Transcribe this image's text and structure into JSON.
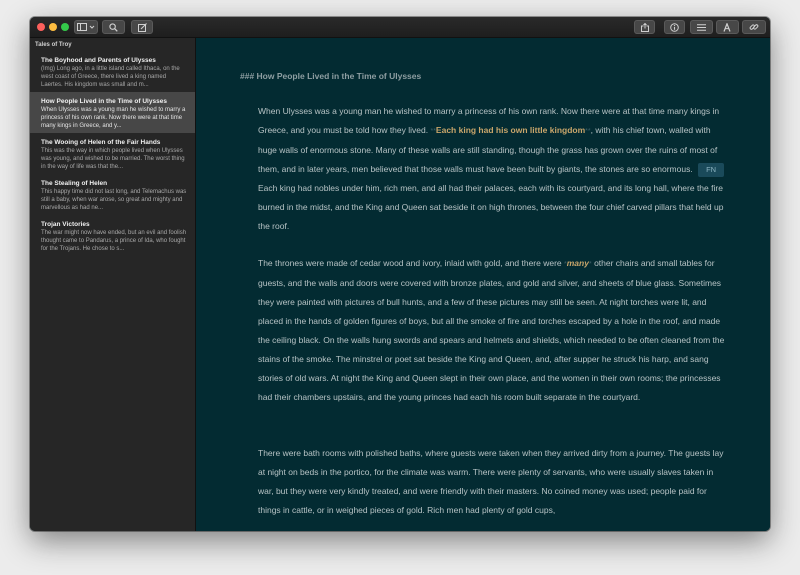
{
  "sidebar": {
    "title": "Tales of Troy",
    "notes": [
      {
        "title": "The Boyhood and Parents of Ulysses",
        "preview": "(Img) Long ago, in a little island called Ithaca, on the west coast of Greece, there lived a king named Laertes. His kingdom was small and m..."
      },
      {
        "title": "How People Lived in the Time of Ulysses",
        "preview": "When Ulysses was a young man he wished to marry a princess of his own rank. Now there were at that time many kings in Greece, and y..."
      },
      {
        "title": "The Wooing of Helen of the Fair Hands",
        "preview": "This was the way in which people lived when Ulysses was young, and wished to be married. The worst thing in the way of life was that the..."
      },
      {
        "title": "The Stealing of Helen",
        "preview": "This happy time did not last long, and Telemachus was still a baby, when war arose, so great and mighty and marvellous as had ne..."
      },
      {
        "title": "Trojan Victories",
        "preview": "The war might now have ended, but an evil and foolish thought came to Pandarus, a prince of Ida, who fought for the Trojans. He chose to s..."
      }
    ]
  },
  "editor": {
    "heading": "### How People Lived in the Time of Ulysses",
    "p1_a": "When Ulysses was a young man he wished to marry a princess of his own rank. Now there were at that time many kings in Greece, and you must be told how they lived. ",
    "p1_mk_open": "**",
    "p1_bold": "Each king had his own little kingdom",
    "p1_mk_close": "**",
    "p1_b": ", with his chief town, walled with huge walls of enormous stone. Many of these walls are still standing, though the grass has grown over the ruins of most of them, and in later years, men believed that those walls must have been built by giants, the stones are so enormous.",
    "p1_fn": "FN",
    "p1_c": "Each king had nobles under him, rich men, and all had their palaces, each with its courtyard, and its long hall, where the fire burned in the midst, and the King and Queen sat beside it on high thrones, between the four chief carved pillars that held up the roof.",
    "p2_a": "The thrones were made of cedar wood and ivory, inlaid with gold, and there were ",
    "p2_mk_open": "*",
    "p2_em": "many",
    "p2_mk_close": "*",
    "p2_b": " other chairs and small tables for guests, and the walls and doors were covered with bronze plates, and gold and silver, and sheets of blue glass. Sometimes they were painted with pictures of bull hunts, and a few of these pictures may still be seen. At night torches were lit, and placed in the hands of golden figures of boys, but all the smoke of fire and torches escaped by a hole in the roof, and made the ceiling black. On the walls hung swords and spears and helmets and shields, which needed to be often cleaned from the stains of the smoke. The minstrel or poet sat beside the King and Queen, and, after supper he struck his harp, and sang stories of old wars. At night the King and Queen slept in their own place, and the women in their own rooms; the princesses had their chambers upstairs, and the young princes had each his room built separate in the courtyard.",
    "p3": "There were bath rooms with polished baths, where guests were taken when they arrived dirty from a journey. The guests lay at night on beds in the portico, for the climate was warm. There were plenty of servants, who were usually slaves taken in war, but they were very kindly treated, and were friendly with their masters. No coined money was used; people paid for things in cattle, or in weighed pieces of gold. Rich men had plenty of gold cups,"
  },
  "colors": {
    "editor_bg": "#032b32",
    "sidebar_bg": "#262626",
    "selected_bg": "#474747",
    "accent": "#c9a66b"
  },
  "icons": [
    "sidebar-toggle-icon",
    "chevron-down-icon",
    "search-icon",
    "compose-icon",
    "share-icon",
    "info-icon",
    "list-icon",
    "font-icon",
    "link-icon"
  ]
}
